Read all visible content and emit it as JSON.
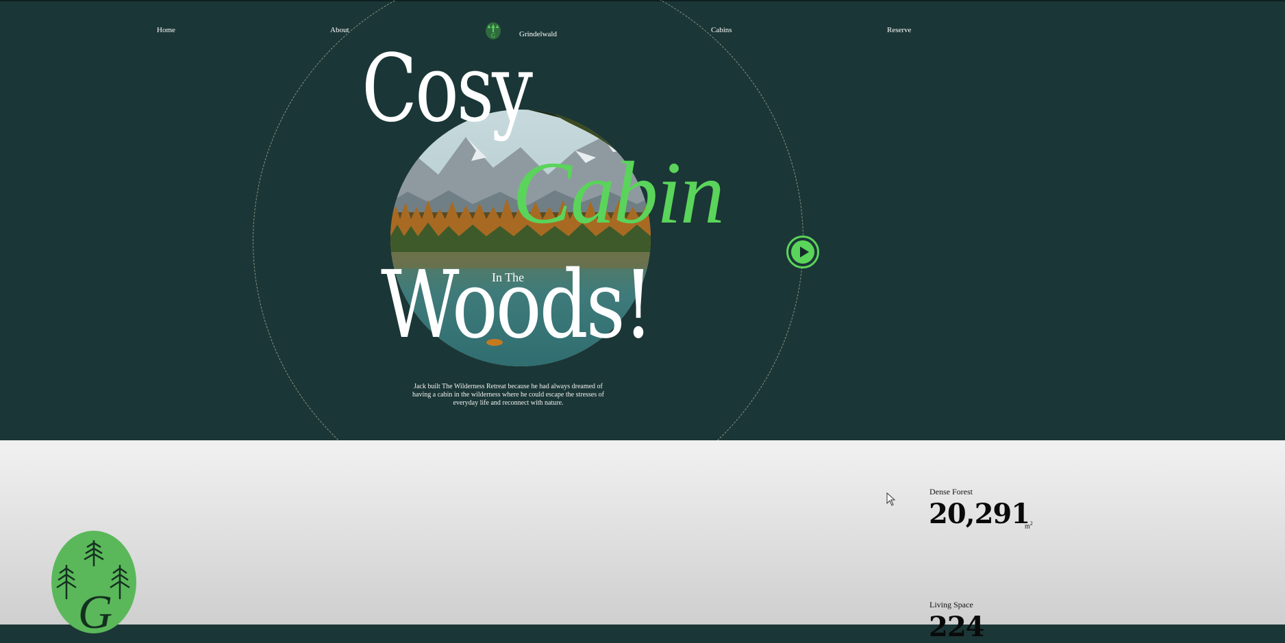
{
  "nav": {
    "home": "Home",
    "about": "About",
    "brand": "Grindelwald",
    "cabins": "Cabins",
    "reserve": "Reserve"
  },
  "hero": {
    "line1": "Cosy",
    "line2": "Cabin",
    "line3_small": "In The",
    "line3": "Woods!",
    "description": "Jack built The Wilderness Retreat because he had always dreamed of having a cabin in the wilderness where he could escape the stresses of everyday life and reconnect with nature."
  },
  "stats": [
    {
      "label": "Dense Forest",
      "value": "20,291",
      "unit": "m",
      "unit_sup": "2"
    },
    {
      "label": "Living Space",
      "value": "224",
      "unit": "",
      "unit_sup": ""
    }
  ],
  "colors": {
    "hero_bg": "#1b3636",
    "accent_green": "#5ad45a",
    "text_light": "#ffffff"
  },
  "icons": {
    "brand": "tree-badge-icon",
    "play": "play-icon",
    "logo": "forest-g-logo-icon",
    "cursor": "mouse-cursor-icon"
  }
}
